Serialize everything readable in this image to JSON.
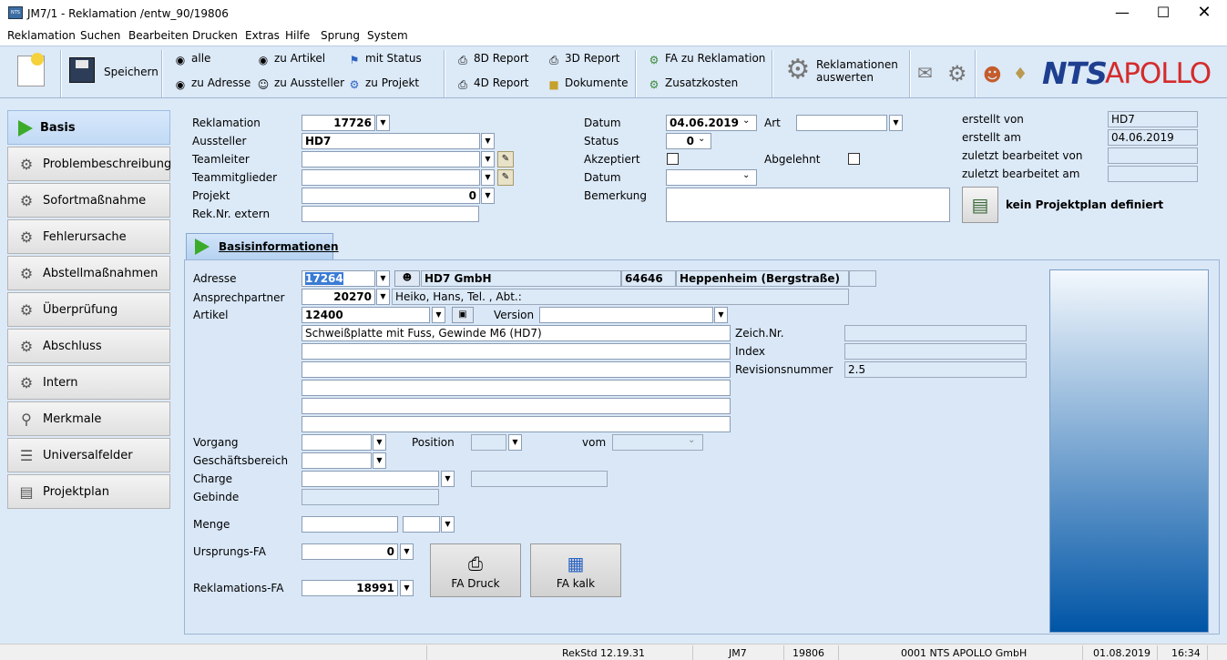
{
  "window": {
    "title": "JM7/1 - Reklamation /entw_90/19806",
    "app_icon_text": "NTS"
  },
  "menu": [
    "Reklamation",
    "Suchen",
    "Bearbeiten",
    "Drucken",
    "Extras",
    "Hilfe",
    "Sprung",
    "System"
  ],
  "toolbar": {
    "save": "Speichern",
    "alle": "alle",
    "zu_artikel": "zu Artikel",
    "mit_status": "mit Status",
    "zu_adresse": "zu Adresse",
    "zu_aussteller": "zu Aussteller",
    "zu_projekt": "zu Projekt",
    "report_8d": "8D Report",
    "report_3d": "3D Report",
    "report_4d": "4D Report",
    "dokumente": "Dokumente",
    "fa_zu_reklamation": "FA zu Reklamation",
    "zusatzkosten": "Zusatzkosten",
    "auswerten_line1": "Reklamationen",
    "auswerten_line2": "auswerten",
    "logo_nts": "NTS",
    "logo_apollo": "APOLLO"
  },
  "nav": [
    {
      "label": "Basis",
      "icon": "play-icon",
      "active": true
    },
    {
      "label": "Problembeschreibung",
      "icon": "gear-icon"
    },
    {
      "label": "Sofortmaßnahme",
      "icon": "gear-icon"
    },
    {
      "label": "Fehlerursache",
      "icon": "gear-error-icon"
    },
    {
      "label": "Abstellmaßnahmen",
      "icon": "gear-icon"
    },
    {
      "label": "Überprüfung",
      "icon": "gear-info-icon"
    },
    {
      "label": "Abschluss",
      "icon": "gear-icon"
    },
    {
      "label": "Intern",
      "icon": "gear-icon"
    },
    {
      "label": "Merkmale",
      "icon": "magnifier-icon"
    },
    {
      "label": "Universalfelder",
      "icon": "list-icon"
    },
    {
      "label": "Projektplan",
      "icon": "plan-icon"
    }
  ],
  "header": {
    "reklamation_label": "Reklamation",
    "reklamation_value": "17726",
    "aussteller_label": "Aussteller",
    "aussteller_value": "HD7",
    "teamleiter_label": "Teamleiter",
    "teammitglieder_label": "Teammitglieder",
    "projekt_label": "Projekt",
    "projekt_value": "0",
    "reknr_label": "Rek.Nr. extern",
    "datum_label": "Datum",
    "datum_value": "04.06.2019",
    "art_label": "Art",
    "status_label": "Status",
    "status_value": "0",
    "akzeptiert_label": "Akzeptiert",
    "abgelehnt_label": "Abgelehnt",
    "datum2_label": "Datum",
    "bemerkung_label": "Bemerkung",
    "erstellt_von_label": "erstellt von",
    "erstellt_von_value": "HD7",
    "erstellt_am_label": "erstellt am",
    "erstellt_am_value": "04.06.2019",
    "bearbeitet_von_label": "zuletzt bearbeitet von",
    "bearbeitet_am_label": "zuletzt bearbeitet am",
    "projektplan_text": "kein Projektplan definiert"
  },
  "tab": {
    "label": "Basisinformationen"
  },
  "basis": {
    "adresse_label": "Adresse",
    "adresse_nr": "17264",
    "adresse_name": "HD7 GmbH",
    "plz": "64646",
    "ort": "Heppenheim (Bergstraße)",
    "ansprech_label": "Ansprechpartner",
    "ansprech_nr": "20270",
    "ansprech_text": "Heiko, Hans, Tel. , Abt.:",
    "artikel_label": "Artikel",
    "artikel_nr": "12400",
    "version_label": "Version",
    "artikel_desc": "Schweißplatte mit Fuss, Gewinde M6 (HD7)",
    "zeichnr_label": "Zeich.Nr.",
    "index_label": "Index",
    "revision_label": "Revisionsnummer",
    "revision_value": "2.5",
    "vorgang_label": "Vorgang",
    "position_label": "Position",
    "vom_label": "vom",
    "geschaeft_label": "Geschäftsbereich",
    "charge_label": "Charge",
    "gebinde_label": "Gebinde",
    "menge_label": "Menge",
    "ursprung_label": "Ursprungs-FA",
    "ursprung_value": "0",
    "rekfa_label": "Reklamations-FA",
    "rekfa_value": "18991",
    "fa_druck": "FA Druck",
    "fa_kalk": "FA kalk"
  },
  "status": {
    "version": "RekStd 12.19.31",
    "module": "JM7",
    "id": "19806",
    "company": "0001 NTS APOLLO GmbH",
    "date": "01.08.2019",
    "time": "16:34"
  }
}
